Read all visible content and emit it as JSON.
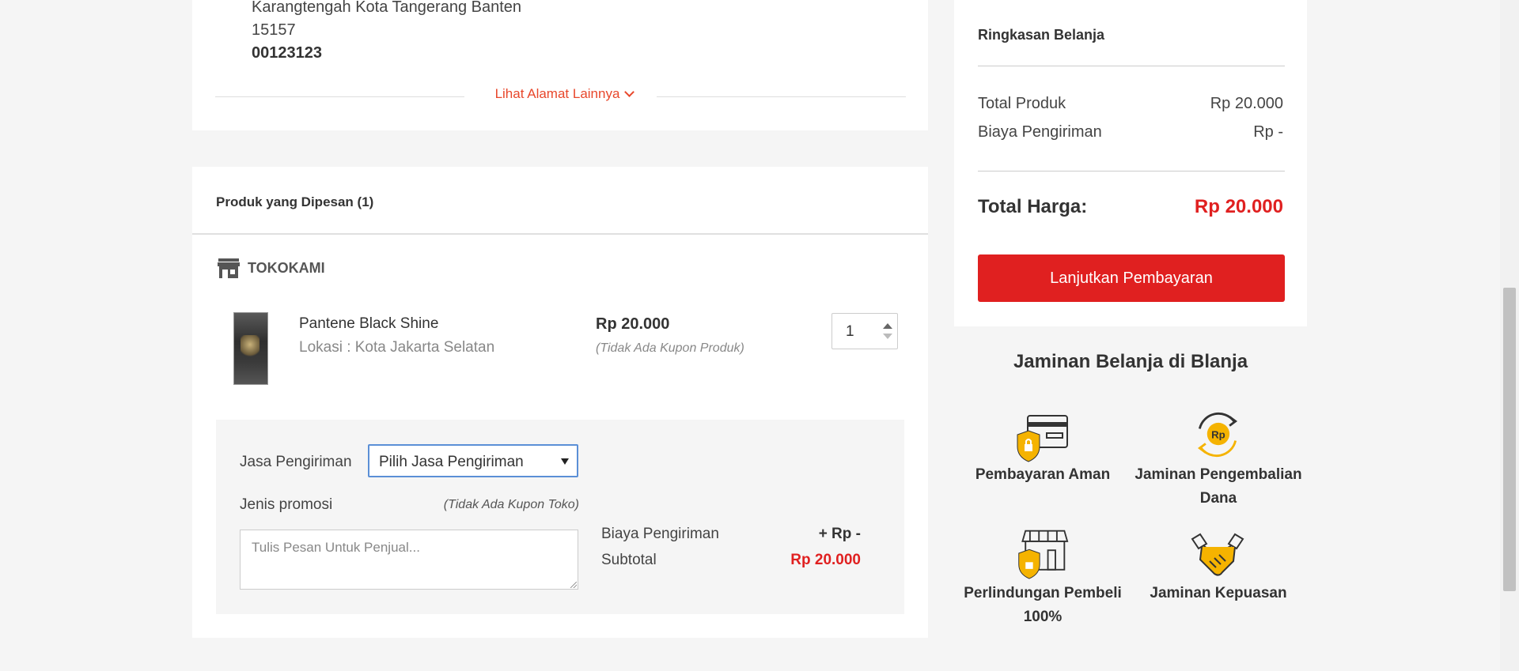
{
  "address": {
    "line1": "Karangtengah Kota Tangerang Banten",
    "postal": "15157",
    "phone": "00123123",
    "more_link": "Lihat Alamat Lainnya"
  },
  "order": {
    "title": "Produk yang Dipesan (1)",
    "store_name": "TOKOKAMI",
    "product": {
      "name": "Pantene Black Shine",
      "location": "Lokasi : Kota Jakarta Selatan",
      "price": "Rp 20.000",
      "coupon_note": "(Tidak Ada Kupon Produk)",
      "quantity": "1"
    },
    "shipping": {
      "label": "Jasa Pengiriman",
      "select_value": "Pilih Jasa Pengiriman",
      "promo_label": "Jenis promosi",
      "promo_note": "(Tidak Ada Kupon Toko)",
      "note_placeholder": "Tulis Pesan Untuk Penjual...",
      "cost_label": "Biaya Pengiriman",
      "cost_value": "+ Rp -",
      "subtotal_label": "Subtotal",
      "subtotal_value": "Rp 20.000"
    }
  },
  "summary": {
    "title": "Ringkasan Belanja",
    "total_produk_label": "Total Produk",
    "total_produk_value": "Rp 20.000",
    "biaya_label": "Biaya Pengiriman",
    "biaya_value": "Rp -",
    "total_label": "Total Harga:",
    "total_value": "Rp 20.000",
    "pay_button": "Lanjutkan Pembayaran"
  },
  "guarantee": {
    "title": "Jaminan Belanja di Blanja",
    "items": [
      {
        "label": "Pembayaran Aman",
        "icon": "secure-payment-icon"
      },
      {
        "label": "Jaminan Pengembalian Dana",
        "icon": "refund-icon"
      },
      {
        "label": "Perlindungan Pembeli 100%",
        "icon": "buyer-protection-icon"
      },
      {
        "label": "Jaminan Kepuasan",
        "icon": "handshake-icon"
      }
    ]
  },
  "colors": {
    "accent_red": "#e02020",
    "link_orange": "#e8472b",
    "icon_gold": "#f5b300"
  }
}
